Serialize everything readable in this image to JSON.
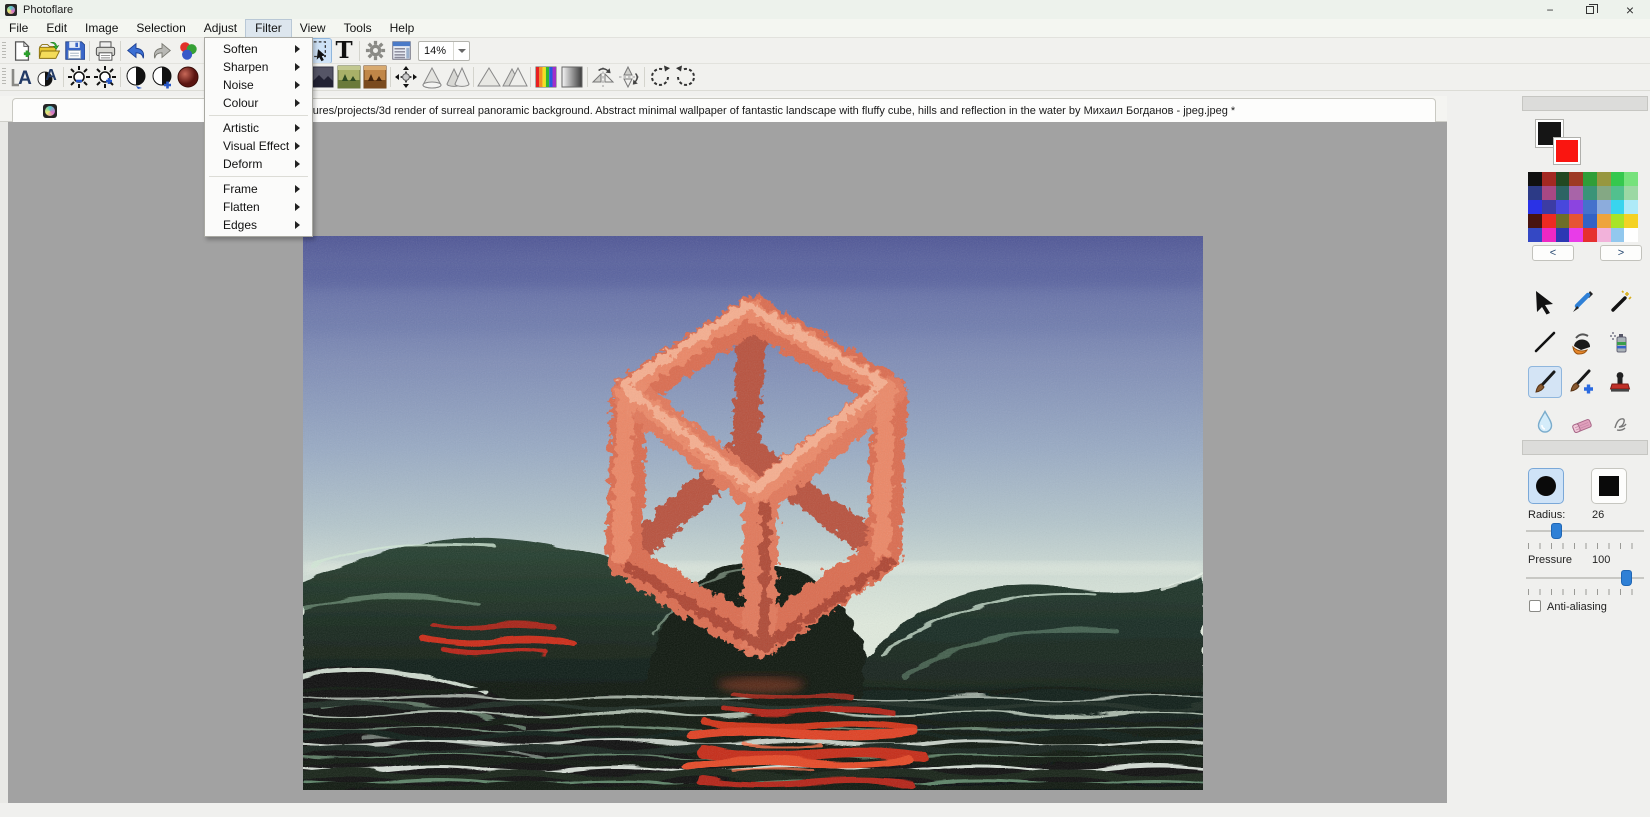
{
  "window": {
    "title": "Photoflare",
    "minimize_glyph": "−",
    "close_glyph": "×"
  },
  "menubar": {
    "items": [
      "File",
      "Edit",
      "Image",
      "Selection",
      "Adjust",
      "Filter",
      "View",
      "Tools",
      "Help"
    ],
    "active_item": "Filter"
  },
  "filter_menu": {
    "items": [
      {
        "label": "Soften"
      },
      {
        "label": "Sharpen"
      },
      {
        "label": "Noise"
      },
      {
        "label": "Colour"
      },
      {
        "label": "Artistic"
      },
      {
        "label": "Visual Effect"
      },
      {
        "label": "Deform"
      },
      {
        "label": "Frame"
      },
      {
        "label": "Flatten"
      },
      {
        "label": "Edges"
      }
    ]
  },
  "toolbar": {
    "zoom_value": "14%",
    "main_icons": [
      "new",
      "open",
      "save",
      "print",
      "undo",
      "redo",
      "colour-balls",
      "rect-select",
      "text",
      "settings",
      "batch-list"
    ],
    "active_tool_icon": "rect-select",
    "filter_icons": [
      "font-size",
      "font-colour",
      "brightness-minus",
      "brightness-plus",
      "contrast",
      "contrast-plus",
      "gamma",
      "landscape-green",
      "landscape-sepia",
      "offset",
      "cone",
      "cone-double",
      "triangle",
      "triangle-double",
      "rainbow",
      "gradient",
      "flip-horizontal",
      "flip-vertical",
      "rotate-ccw",
      "rotate-cw"
    ]
  },
  "document_tab": {
    "title": "C:/Users/Nolen/Pictures/projects/3d render of surreal panoramic background. Abstract minimal wallpaper of fantastic landscape with fluffy cube, hills and reflection in the water by Михаил Богданов - jpeg.jpeg *",
    "close_glyph": "×"
  },
  "canvas": {
    "image_description": "3d render: fuzzy coral wireframe cube floating over dark glossy green hills with red reflection in rippled water"
  },
  "right_panel": {
    "foreground_color": "#151515",
    "background_color": "#fa1510",
    "palette": [
      [
        "#101010",
        "#a32822",
        "#224822",
        "#9e3a24",
        "#2f9e38",
        "#97973f",
        "#35c84e",
        "#76e27c"
      ],
      [
        "#2c3a86",
        "#a84884",
        "#2c6464",
        "#a864a8",
        "#3a9478",
        "#84a884",
        "#52c08e",
        "#9cd8a4"
      ],
      [
        "#2a32e6",
        "#3c3ca4",
        "#4848dc",
        "#8c44e0",
        "#4472cc",
        "#8cacdc",
        "#38d4ee",
        "#aeeaf8"
      ],
      [
        "#481410",
        "#ee2a22",
        "#6e6e28",
        "#e65434",
        "#3462c4",
        "#eea43c",
        "#a8e428",
        "#f4d224"
      ],
      [
        "#3448c4",
        "#ee28c4",
        "#2c38b4",
        "#e83ce8",
        "#e63030",
        "#f2b2da",
        "#92c8ee",
        "#ffffff"
      ]
    ],
    "prev_label": "<",
    "next_label": ">",
    "tools": [
      "pointer",
      "dropper",
      "magic-wand",
      "line",
      "fill",
      "spray",
      "paintbrush",
      "paintbrush-advanced",
      "stamp",
      "blur",
      "eraser",
      "smudge"
    ],
    "selected_tool": "paintbrush",
    "brush_settings": {
      "shape_selected": "circle",
      "radius_label": "Radius:",
      "radius_value": "26",
      "radius_percent": 25,
      "pressure_label": "Pressure",
      "pressure_value": "100",
      "pressure_percent": 85,
      "antialias_label": "Anti-aliasing",
      "antialias_checked": false
    }
  }
}
